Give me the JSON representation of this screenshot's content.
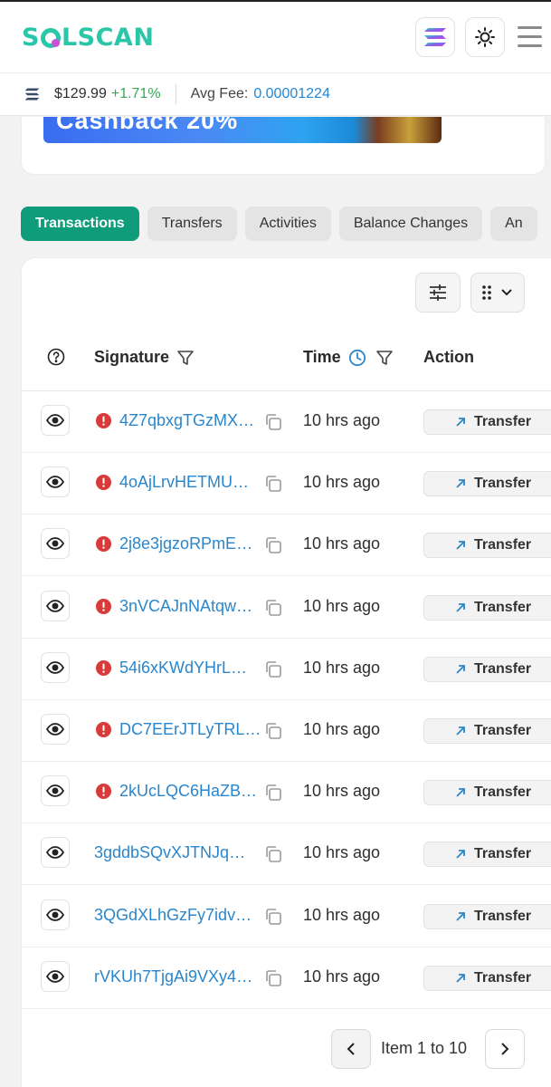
{
  "header": {
    "logo_left": "S",
    "logo_right": "LSCAN"
  },
  "pricebar": {
    "price": "$129.99",
    "change": "+1.71%",
    "fee_label": "Avg Fee:",
    "fee_value": "0.00001224"
  },
  "banner": {
    "text": "Cashback 20%"
  },
  "tabs": [
    {
      "label": "Transactions",
      "active": true
    },
    {
      "label": "Transfers"
    },
    {
      "label": "Activities"
    },
    {
      "label": "Balance Changes"
    },
    {
      "label": "An"
    }
  ],
  "table": {
    "columns": {
      "signature": "Signature",
      "time": "Time",
      "action": "Action"
    },
    "rows": [
      {
        "signature": "4Z7qbxgTGzMX…",
        "error": true,
        "time": "10 hrs ago",
        "action": "Transfer"
      },
      {
        "signature": "4oAjLrvHETMU…",
        "error": true,
        "time": "10 hrs ago",
        "action": "Transfer"
      },
      {
        "signature": "2j8e3jgzoRPmE…",
        "error": true,
        "time": "10 hrs ago",
        "action": "Transfer"
      },
      {
        "signature": "3nVCAJnNAtqw…",
        "error": true,
        "time": "10 hrs ago",
        "action": "Transfer"
      },
      {
        "signature": "54i6xKWdYHrL…",
        "error": true,
        "time": "10 hrs ago",
        "action": "Transfer"
      },
      {
        "signature": "DC7EErJTLyTRL…",
        "error": true,
        "time": "10 hrs ago",
        "action": "Transfer"
      },
      {
        "signature": "2kUcLQC6HaZB…",
        "error": true,
        "time": "10 hrs ago",
        "action": "Transfer"
      },
      {
        "signature": "3gddbSQvXJTNJq…",
        "error": false,
        "time": "10 hrs ago",
        "action": "Transfer"
      },
      {
        "signature": "3QGdXLhGzFy7idv…",
        "error": false,
        "time": "10 hrs ago",
        "action": "Transfer"
      },
      {
        "signature": "rVKUh7TjgAi9VXy4…",
        "error": false,
        "time": "10 hrs ago",
        "action": "Transfer"
      }
    ]
  },
  "pagination": {
    "label": "Item 1 to 10"
  },
  "colors": {
    "brand": "#2bc5a7",
    "active_tab": "#0f9c7b",
    "link": "#2a86cc",
    "error": "#d93a3a",
    "positive": "#3aa856"
  }
}
